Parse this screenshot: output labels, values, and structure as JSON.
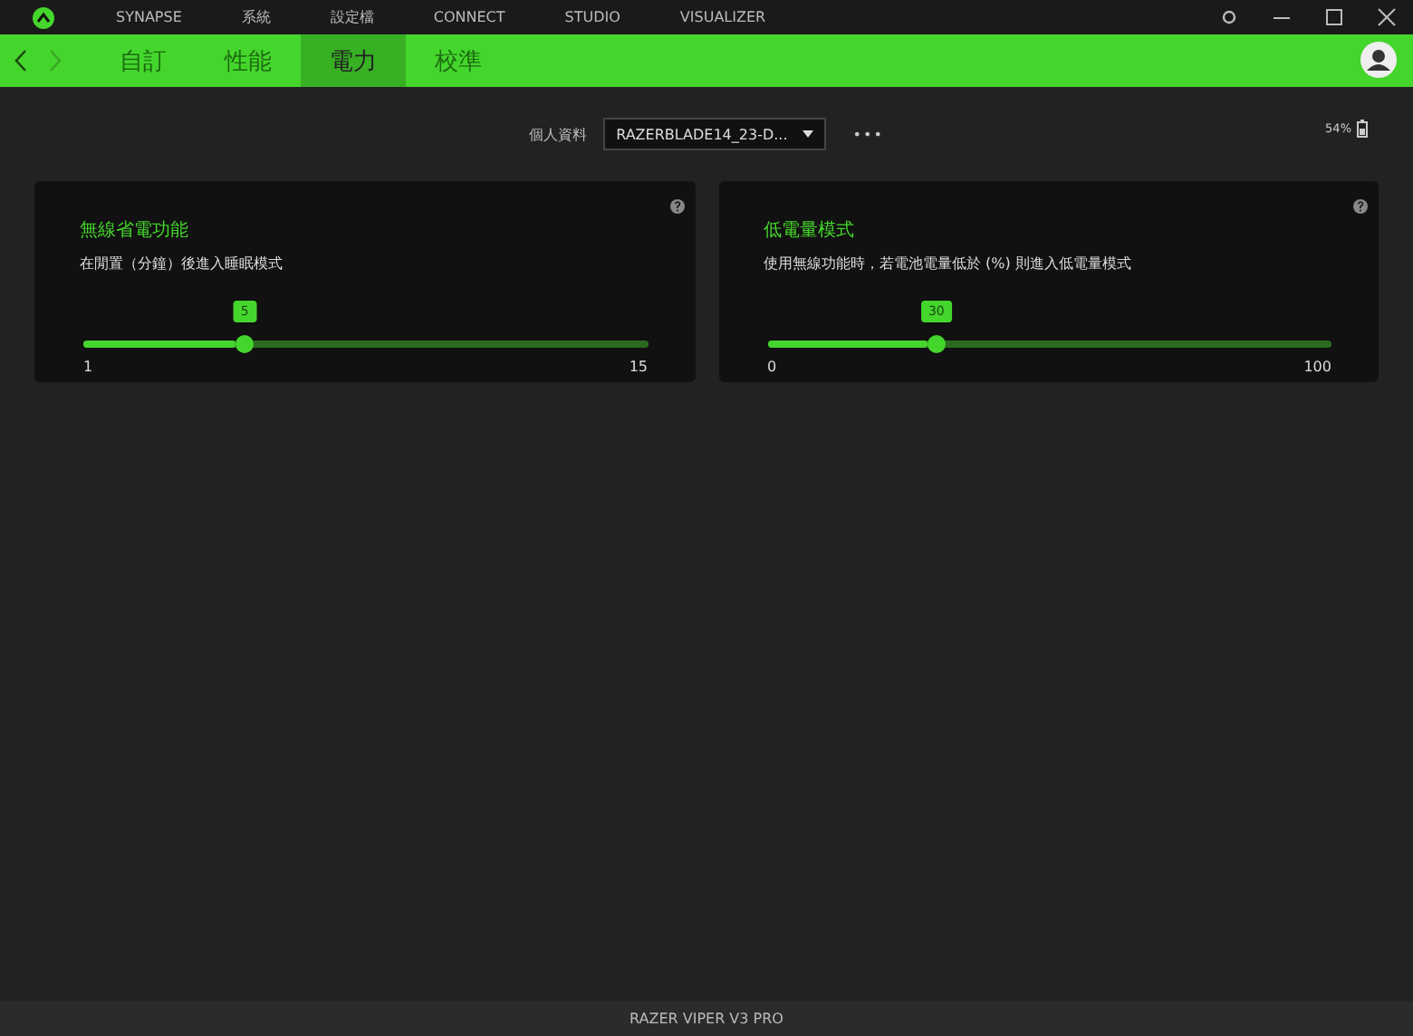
{
  "title_bar": {
    "nav": [
      {
        "label": "SYNAPSE",
        "selected": false
      },
      {
        "label": "系統",
        "selected": false
      },
      {
        "label": "設定檔",
        "selected": false
      },
      {
        "label": "CONNECT",
        "selected": false
      },
      {
        "label": "STUDIO",
        "selected": false
      },
      {
        "label": "VISUALIZER",
        "selected": false
      }
    ]
  },
  "tabs": [
    {
      "label": "自訂",
      "selected": false
    },
    {
      "label": "性能",
      "selected": false
    },
    {
      "label": "電力",
      "selected": true
    },
    {
      "label": "校準",
      "selected": false
    }
  ],
  "profile": {
    "label": "個人資料",
    "value": "RAZERBLADE14_23-D...",
    "more": "•••"
  },
  "battery": {
    "reading": "54%"
  },
  "cards": [
    {
      "title": "無線省電功能",
      "description": "在閒置（分鐘）後進入睡眠模式",
      "value": "5",
      "level": 0.286,
      "min": "1",
      "max": "15"
    },
    {
      "title": "低電量模式",
      "description": "使用無線功能時，若電池電量低於 (%) 則進入低電量模式",
      "value": "30",
      "level": 0.3,
      "min": "0",
      "max": "100"
    }
  ],
  "footer": {
    "device": "RAZER VIPER V3 PRO"
  }
}
